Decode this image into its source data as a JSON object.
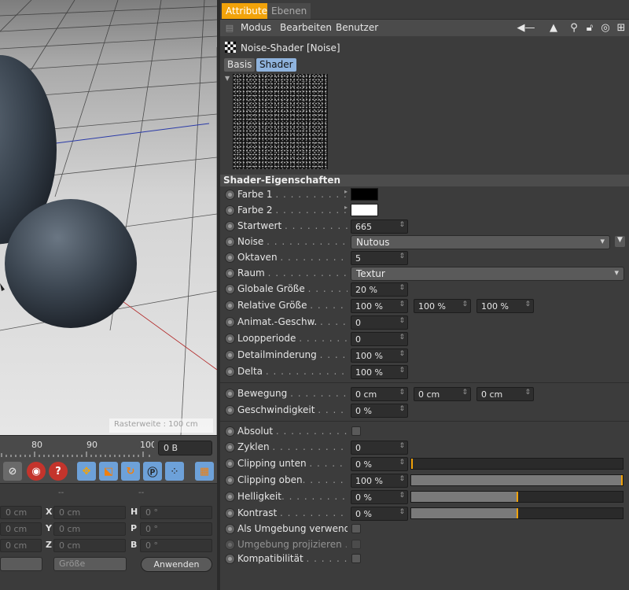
{
  "viewport": {
    "watermark": "Rasterweite : 100 cm"
  },
  "timeline": {
    "ticks": [
      "80",
      "90",
      "100"
    ],
    "frame": "0 B"
  },
  "coord": {
    "header_dash": "--",
    "rows": [
      {
        "label_a": "X",
        "value_a": "0 cm",
        "label_b": "H",
        "value_b": "0 °"
      },
      {
        "label_a": "Y",
        "value_a": "0 cm",
        "label_b": "P",
        "value_b": "0 °"
      },
      {
        "label_a": "Z",
        "value_a": "0 cm",
        "label_b": "B",
        "value_b": "0 °"
      }
    ],
    "size_dropdown": "Größe",
    "apply": "Anwenden"
  },
  "panel": {
    "tabs": [
      "Attribute",
      "Ebenen"
    ],
    "menu": [
      "Modus",
      "Bearbeiten",
      "Benutzer"
    ],
    "object_title": "Noise-Shader [Noise]",
    "subtabs": [
      "Basis",
      "Shader"
    ],
    "section_title": "Shader-Eigenschaften",
    "colors": {
      "accent": "#f2a30a",
      "farbe1": "#000000",
      "farbe2": "#ffffff"
    },
    "props": {
      "farbe1": "Farbe 1",
      "farbe2": "Farbe 2",
      "startwert": {
        "label": "Startwert",
        "value": "665"
      },
      "noise": {
        "label": "Noise",
        "value": "Nutous"
      },
      "oktaven": {
        "label": "Oktaven",
        "value": "5"
      },
      "raum": {
        "label": "Raum",
        "value": "Textur"
      },
      "globale": {
        "label": "Globale Größe",
        "value": "20 %"
      },
      "relative": {
        "label": "Relative Größe",
        "v1": "100 %",
        "v2": "100 %",
        "v3": "100 %"
      },
      "animat": {
        "label": "Animat.-Geschw.",
        "value": "0"
      },
      "loop": {
        "label": "Loopperiode",
        "value": "0"
      },
      "detail": {
        "label": "Detailminderung",
        "value": "100 %"
      },
      "delta": {
        "label": "Delta",
        "value": "100 %"
      },
      "bewegung": {
        "label": "Bewegung",
        "v1": "0 cm",
        "v2": "0 cm",
        "v3": "0 cm"
      },
      "geschw": {
        "label": "Geschwindigkeit",
        "value": "0 %"
      },
      "absolut": {
        "label": "Absolut"
      },
      "zyklen": {
        "label": "Zyklen",
        "value": "0"
      },
      "clip_unten": {
        "label": "Clipping unten",
        "value": "0 %",
        "fill": 0
      },
      "clip_oben": {
        "label": "Clipping oben",
        "value": "100 %",
        "fill": 1
      },
      "hell": {
        "label": "Helligkeit",
        "value": "0 %",
        "fill": 0.5
      },
      "kontrast": {
        "label": "Kontrast",
        "value": "0 %",
        "fill": 0.5
      },
      "umgebung": {
        "label": "Als Umgebung verwenden"
      },
      "projiz": {
        "label": "Umgebung projizieren"
      },
      "kompat": {
        "label": "Kompatibilität"
      }
    }
  }
}
